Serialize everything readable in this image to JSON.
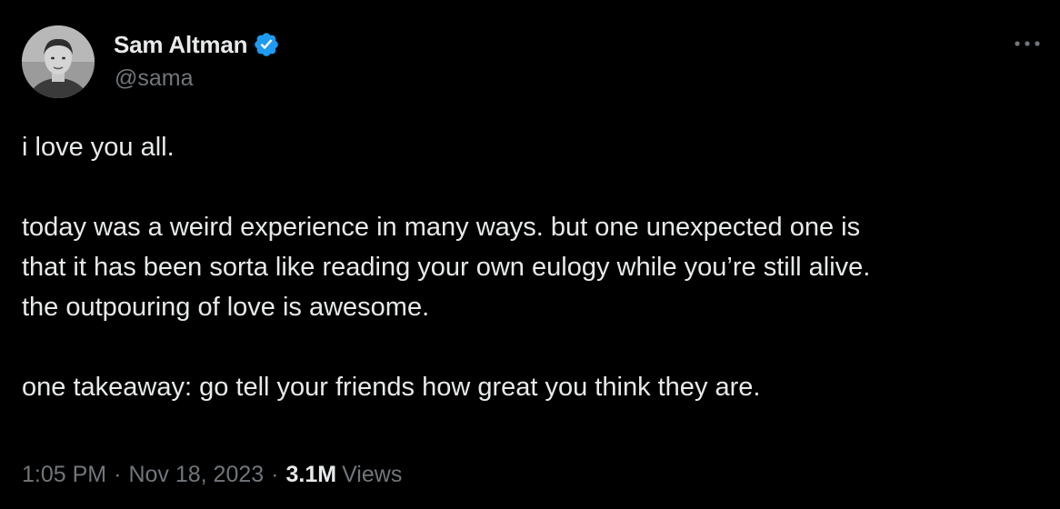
{
  "author": {
    "name": "Sam Altman",
    "handle": "@sama",
    "verified": true,
    "verified_color": "#1d9bf0"
  },
  "tweet": {
    "paragraphs": [
      [
        "i love you all."
      ],
      [
        "today was a weird experience in many ways. but one unexpected one is",
        "that it has been sorta like reading your own eulogy while you’re still alive.",
        "the outpouring of love is awesome."
      ],
      [
        "one takeaway: go tell your friends how great you think they are."
      ]
    ]
  },
  "meta": {
    "time": "1:05 PM",
    "separator": "·",
    "date": "Nov 18, 2023",
    "views_count": "3.1M",
    "views_label": "Views"
  },
  "icons": {
    "verified": "verified-badge-icon",
    "more": "more-options-icon"
  },
  "colors": {
    "background": "#000000",
    "text_primary": "#e7e9ea",
    "text_secondary": "#71767b"
  }
}
